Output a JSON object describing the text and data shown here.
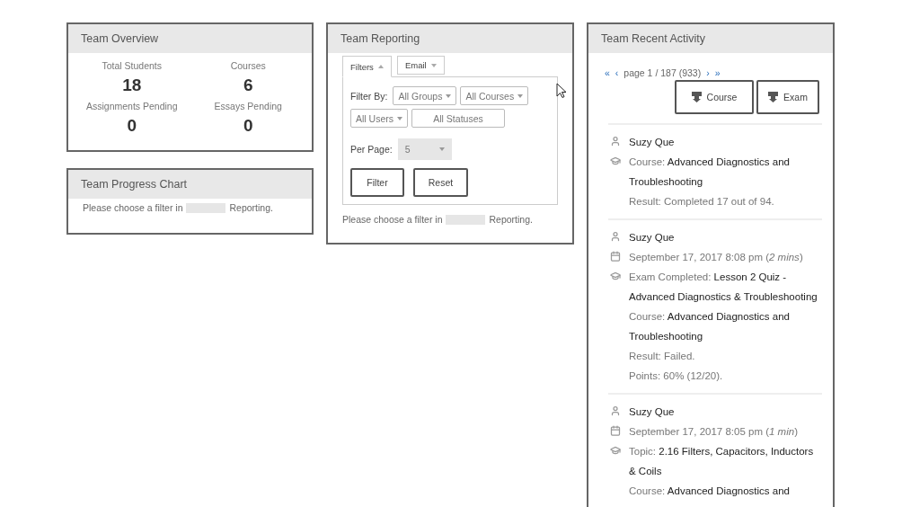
{
  "overview": {
    "title": "Team Overview",
    "stats": [
      {
        "label": "Total Students",
        "value": "18"
      },
      {
        "label": "Courses",
        "value": "6"
      },
      {
        "label": "Assignments Pending",
        "value": "0"
      },
      {
        "label": "Essays Pending",
        "value": "0"
      }
    ]
  },
  "progress_chart": {
    "title": "Team Progress Chart",
    "message_before": "Please choose a filter in",
    "message_after": "Reporting."
  },
  "reporting": {
    "title": "Team Reporting",
    "tabs": [
      {
        "label": "Filters",
        "selected": true
      },
      {
        "label": "Email",
        "selected": false
      }
    ],
    "filter_label": "Filter By:",
    "filters": [
      {
        "kind": "select",
        "value": "All Groups"
      },
      {
        "kind": "select",
        "value": "All Courses"
      },
      {
        "kind": "select",
        "value": "All Users"
      },
      {
        "kind": "field",
        "value": "All Statuses"
      }
    ],
    "per_page_label": "Per Page:",
    "per_page": {
      "value": "5",
      "disabled": true
    },
    "buttons": [
      "Filter",
      "Reset"
    ],
    "message_before": "Please choose a filter in",
    "message_after": "Reporting."
  },
  "activity": {
    "title": "Team Recent Activity",
    "pagination": {
      "first": "«",
      "prev": "‹",
      "label": "page 1 / 187 (933)",
      "next": "›",
      "last": "»"
    },
    "buttons": [
      "Course",
      "Exam"
    ],
    "items": [
      {
        "lines": [
          {
            "kind": "user",
            "text": "Suzy Que"
          },
          {
            "kind": "course",
            "text": "Course: **Advanced Diagnostics and Troubleshooting**"
          },
          {
            "kind": "plain",
            "text": "Result: Completed 17 out of 94."
          }
        ]
      },
      {
        "lines": [
          {
            "kind": "user",
            "text": "Suzy Que"
          },
          {
            "kind": "date",
            "text": "September 17, 2017 8:08 pm (*2 mins*)"
          },
          {
            "kind": "course",
            "text": "Exam Completed: **Lesson 2 Quiz - Advanced Diagnostics & Troubleshooting**"
          },
          {
            "kind": "plain",
            "text": "Course: **Advanced Diagnostics and Troubleshooting**"
          },
          {
            "kind": "plain",
            "text": "Result: Failed."
          },
          {
            "kind": "plain",
            "text": "Points: 60% (12/20)."
          }
        ]
      },
      {
        "lines": [
          {
            "kind": "user",
            "text": "Suzy Que"
          },
          {
            "kind": "date",
            "text": "September 17, 2017 8:05 pm (*1 min*)"
          },
          {
            "kind": "course",
            "text": "Topic: **2.16 Filters, Capacitors, Inductors & Coils**"
          },
          {
            "kind": "plain",
            "text": "Course: **Advanced Diagnostics and**"
          }
        ]
      }
    ]
  }
}
